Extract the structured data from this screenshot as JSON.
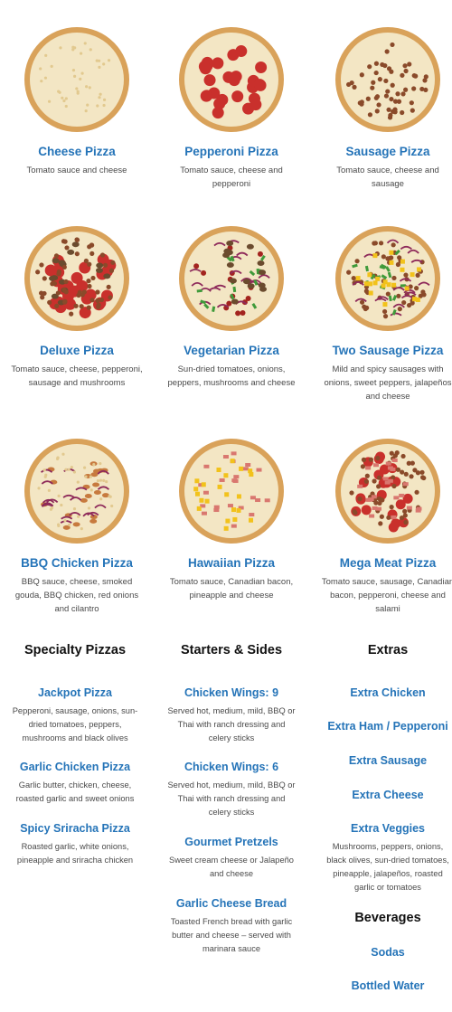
{
  "pizzas": [
    {
      "name": "Cheese Pizza",
      "desc": "Tomato sauce and cheese",
      "style": "cheese"
    },
    {
      "name": "Pepperoni Pizza",
      "desc": "Tomato sauce, cheese and pepperoni",
      "style": "pepperoni"
    },
    {
      "name": "Sausage Pizza",
      "desc": "Tomato sauce, cheese and sausage",
      "style": "sausage"
    },
    {
      "name": "Deluxe Pizza",
      "desc": "Tomato sauce, cheese, pepperoni, sausage and mushrooms",
      "style": "deluxe"
    },
    {
      "name": "Vegetarian Pizza",
      "desc": "Sun-dried tomatoes, onions, peppers, mushrooms and cheese",
      "style": "veggie"
    },
    {
      "name": "Two Sausage Pizza",
      "desc": "Mild and spicy sausages with onions, sweet peppers, jalapeños and cheese",
      "style": "twosausage"
    },
    {
      "name": "BBQ Chicken Pizza",
      "desc": "BBQ sauce, cheese, smoked gouda, BBQ chicken, red onions and cilantro",
      "style": "bbq"
    },
    {
      "name": "Hawaiian Pizza",
      "desc": "Tomato sauce, Canadian bacon, pineapple and cheese",
      "style": "hawaiian"
    },
    {
      "name": "Mega Meat Pizza",
      "desc": "Tomato sauce, sausage, Canadian bacon, pepperoni, cheese and salami",
      "style": "megameat"
    }
  ],
  "specialty": {
    "heading": "Specialty Pizzas",
    "items": [
      {
        "name": "Jackpot Pizza",
        "desc": "Pepperoni, sausage, onions, sun-dried tomatoes, peppers, mushrooms and black olives"
      },
      {
        "name": "Garlic Chicken Pizza",
        "desc": "Garlic butter, chicken, cheese, roasted garlic and sweet onions"
      },
      {
        "name": "Spicy Sriracha Pizza",
        "desc": "Roasted garlic, white onions, pineapple and sriracha chicken"
      }
    ]
  },
  "starters": {
    "heading": "Starters & Sides",
    "items": [
      {
        "name": "Chicken Wings: 9",
        "desc": "Served hot, medium, mild, BBQ or Thai with ranch dressing and celery sticks"
      },
      {
        "name": "Chicken Wings: 6",
        "desc": "Served hot, medium, mild, BBQ or Thai with ranch dressing and celery sticks"
      },
      {
        "name": "Gourmet Pretzels",
        "desc": "Sweet cream cheese or Jalapeño and cheese"
      },
      {
        "name": "Garlic Cheese Bread",
        "desc": "Toasted French bread with garlic butter and cheese – served with marinara sauce"
      }
    ]
  },
  "extras": {
    "heading": "Extras",
    "items": [
      {
        "name": "Extra Chicken"
      },
      {
        "name": "Extra Ham / Pepperoni"
      },
      {
        "name": "Extra Sausage"
      },
      {
        "name": "Extra Cheese"
      },
      {
        "name": "Extra Veggies",
        "desc": "Mushrooms, peppers, onions, black olives, sun-dried tomatoes, pineapple, jalapeños, roasted garlic or tomatoes"
      }
    ],
    "beverages_heading": "Beverages",
    "beverages": [
      {
        "name": "Sodas"
      },
      {
        "name": "Bottled Water"
      }
    ]
  },
  "colors": {
    "link_blue": "#2574b8",
    "crust": "#d9a25a",
    "cheese": "#f3e6c4",
    "pepperoni": "#c9302c",
    "sausage": "#8a4a2a"
  }
}
